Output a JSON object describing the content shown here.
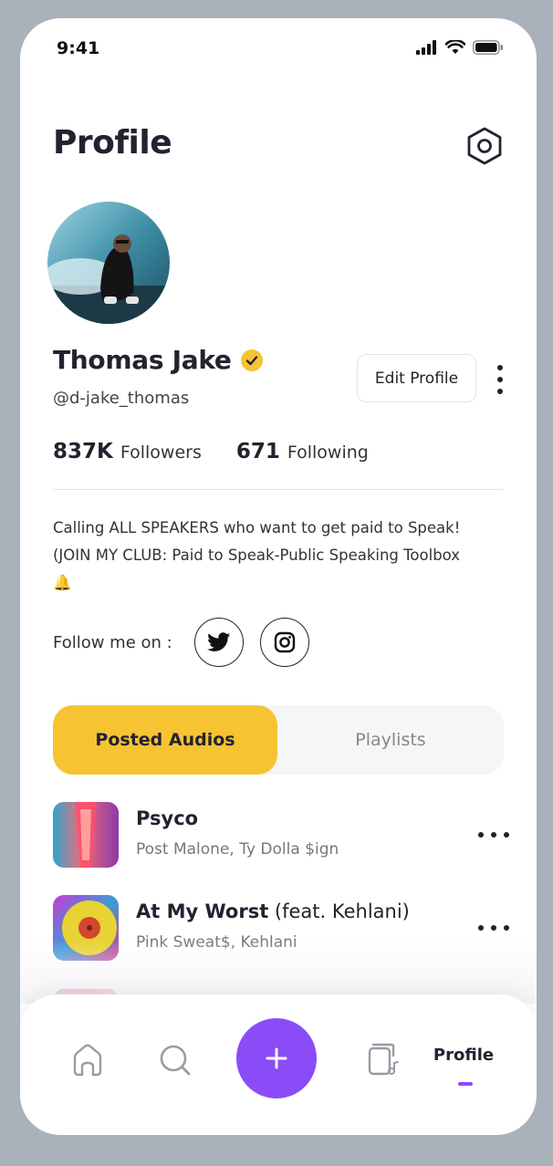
{
  "status_bar": {
    "time": "9:41"
  },
  "header": {
    "title": "Profile",
    "settings_icon": "hexagon-settings-icon"
  },
  "profile": {
    "name": "Thomas Jake",
    "verified_icon": "verified-check-icon",
    "handle": "@d-jake_thomas",
    "edit_label": "Edit Profile",
    "followers_count": "837K",
    "followers_label": "Followers",
    "following_count": "671",
    "following_label": "Following",
    "bio_line1": "Calling  ALL SPEAKERS who want to get paid to Speak!",
    "bio_line2": "(JOIN MY CLUB: Paid to Speak-Public Speaking Toolbox",
    "bio_emoji": "🔔",
    "follow_label": "Follow me on :"
  },
  "tabs": {
    "active": "Posted Audios",
    "inactive": "Playlists"
  },
  "tracks": [
    {
      "title": "Psyco",
      "title_suffix": "",
      "artists": "Post Malone, Ty Dolla $ign"
    },
    {
      "title": "At My Worst",
      "title_suffix": " (feat. Kehlani)",
      "artists": "Pink Sweat$, Kehlani"
    }
  ],
  "nav": {
    "profile_label": "Profile"
  },
  "colors": {
    "accent_yellow": "#f6c332",
    "accent_purple": "#8b4cf7",
    "text_dark": "#222230"
  }
}
